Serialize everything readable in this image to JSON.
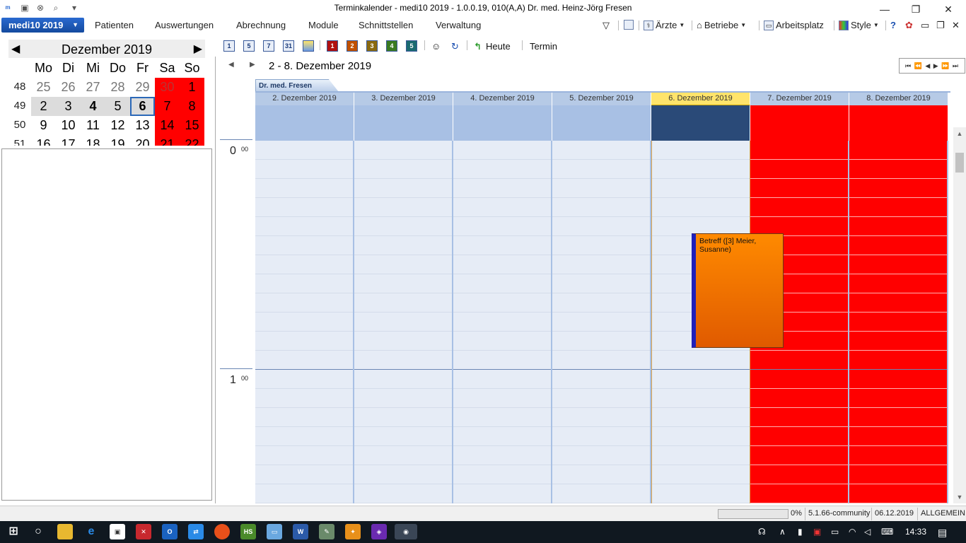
{
  "window": {
    "title": "Terminkalender - medi10 2019 - 1.0.0.19, 010(A,A) Dr. med. Heinz-Jörg Fresen",
    "minimize_glyph": "—",
    "restore_glyph": "❐",
    "close_glyph": "✕"
  },
  "menu": {
    "app_button": "medi10 2019",
    "items": [
      "Patienten",
      "Auswertungen",
      "Abrechnung",
      "Module",
      "Schnittstellen",
      "Verwaltung"
    ],
    "right": {
      "aerzte": "Ärzte",
      "betriebe": "Betriebe",
      "arbeitsplatz": "Arbeitsplatz",
      "style": "Style"
    }
  },
  "mini_calendar": {
    "title": "Dezember 2019",
    "weekdays": [
      "Mo",
      "Di",
      "Mi",
      "Do",
      "Fr",
      "Sa",
      "So"
    ],
    "weeks": [
      {
        "wk": "48",
        "days": [
          "25",
          "26",
          "27",
          "28",
          "29",
          "30",
          "1"
        ]
      },
      {
        "wk": "49",
        "days": [
          "2",
          "3",
          "4",
          "5",
          "6",
          "7",
          "8"
        ]
      },
      {
        "wk": "50",
        "days": [
          "9",
          "10",
          "11",
          "12",
          "13",
          "14",
          "15"
        ]
      },
      {
        "wk": "51",
        "days": [
          "16",
          "17",
          "18",
          "19",
          "20",
          "21",
          "22"
        ]
      }
    ]
  },
  "toolbar": {
    "view_buttons": [
      "1",
      "5",
      "7",
      "31"
    ],
    "level_buttons": [
      "1",
      "2",
      "3",
      "4",
      "5"
    ],
    "today_label": "Heute",
    "termin_label": "Termin"
  },
  "calendar": {
    "range_title": "2 - 8. Dezember 2019",
    "resource_tab": "Dr. med. Fresen",
    "days": [
      "2. Dezember 2019",
      "3. Dezember 2019",
      "4. Dezember 2019",
      "5. Dezember 2019",
      "6. Dezember 2019",
      "7. Dezember 2019",
      "8. Dezember 2019"
    ],
    "hours": [
      {
        "h": "0",
        "m": "00"
      },
      {
        "h": "1",
        "m": "00"
      }
    ],
    "appointment": {
      "text": "Betreff ([3] Meier, Susanne)",
      "color": "#ff8000",
      "status_color": "#2020b8"
    },
    "weekend_color": "#ff0000"
  },
  "statusbar": {
    "progress": "0%",
    "version": "5.1.66-community",
    "date": "06.12.2019",
    "mode": "ALLGEMEIN"
  },
  "taskbar": {
    "clock": "14:33"
  }
}
